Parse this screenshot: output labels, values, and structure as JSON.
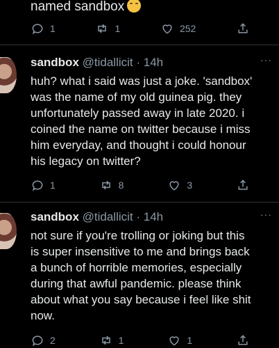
{
  "prev_tweet": {
    "text_tail": "named sandbox",
    "emoji": "crying-face",
    "actions": {
      "replies": "1",
      "retweets": "1",
      "likes": "252",
      "share": ""
    }
  },
  "tweets": [
    {
      "display_name": "sandbox",
      "handle": "@tidallicit",
      "time": "14h",
      "more": "···",
      "text": "huh? what i said was just a joke. 'sandbox'\nwas the name of my old guinea pig. they\nunfortunately passed away in late 2020. i\ncoined the name on twitter because i miss\nhim everyday, and thought i could honour\nhis legacy on twitter?",
      "actions": {
        "replies": "1",
        "retweets": "8",
        "likes": "3",
        "share": ""
      }
    },
    {
      "display_name": "sandbox",
      "handle": "@tidallicit",
      "time": "14h",
      "more": "···",
      "text": "not sure if you're trolling or joking but this\nis super insensitive to me and brings back\na bunch of horrible memories, especially\nduring that awful pandemic. please think\nabout what you say because i feel like shit\nnow.",
      "actions": {
        "replies": "2",
        "retweets": "1",
        "likes": "1",
        "share": ""
      }
    }
  ]
}
